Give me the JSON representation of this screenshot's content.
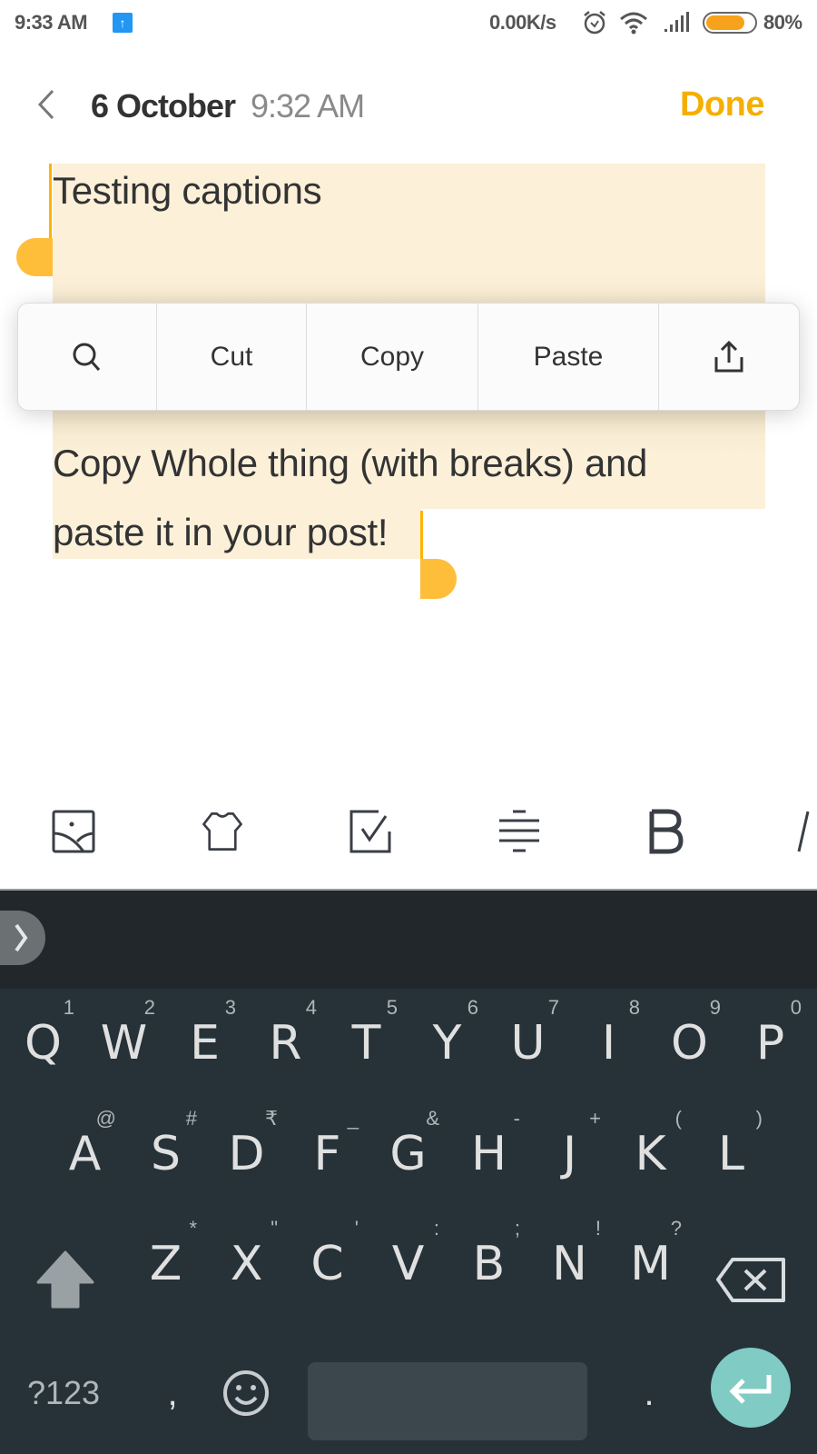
{
  "status_bar": {
    "time": "9:33 AM",
    "upload_icon": "upload-arrow-icon",
    "net_speed": "0.00K/s",
    "icons": [
      "alarm-icon",
      "wifi-icon",
      "signal-icon",
      "battery-icon"
    ],
    "battery_percent": "80%",
    "battery_level": 0.8
  },
  "header": {
    "back_icon": "chevron-left-icon",
    "date": "6 October",
    "time": "9:32 AM",
    "done_label": "Done"
  },
  "note": {
    "lines": [
      "Testing captions",
      "Copy Whole thing (with breaks) and",
      "paste it in your post!"
    ]
  },
  "context_menu": {
    "search_icon": "search-icon",
    "cut": "Cut",
    "copy": "Copy",
    "paste": "Paste",
    "share_icon": "share-icon"
  },
  "toolbar": {
    "items": [
      "image-icon",
      "theme-shirt-icon",
      "checklist-icon",
      "align-icon",
      "bold-icon",
      "italic-icon"
    ],
    "bold_glyph": "B",
    "italic_glyph": "I"
  },
  "keyboard": {
    "row1": [
      {
        "key": "Q",
        "hint": "1"
      },
      {
        "key": "W",
        "hint": "2"
      },
      {
        "key": "E",
        "hint": "3"
      },
      {
        "key": "R",
        "hint": "4"
      },
      {
        "key": "T",
        "hint": "5"
      },
      {
        "key": "Y",
        "hint": "6"
      },
      {
        "key": "U",
        "hint": "7"
      },
      {
        "key": "I",
        "hint": "8"
      },
      {
        "key": "O",
        "hint": "9"
      },
      {
        "key": "P",
        "hint": "0"
      }
    ],
    "row2": [
      {
        "key": "A",
        "hint": "@"
      },
      {
        "key": "S",
        "hint": "#"
      },
      {
        "key": "D",
        "hint": "₹"
      },
      {
        "key": "F",
        "hint": "_"
      },
      {
        "key": "G",
        "hint": "&"
      },
      {
        "key": "H",
        "hint": "-"
      },
      {
        "key": "J",
        "hint": "+"
      },
      {
        "key": "K",
        "hint": "("
      },
      {
        "key": "L",
        "hint": ")"
      }
    ],
    "row3": [
      {
        "key": "Z",
        "hint": "*"
      },
      {
        "key": "X",
        "hint": "\""
      },
      {
        "key": "C",
        "hint": "'"
      },
      {
        "key": "V",
        "hint": ":"
      },
      {
        "key": "B",
        "hint": ";"
      },
      {
        "key": "N",
        "hint": "!"
      },
      {
        "key": "M",
        "hint": "?"
      }
    ],
    "symbols_label": "?123",
    "comma": ",",
    "period": ".",
    "enter_color": "#80CBC4"
  },
  "colors": {
    "accent": "#F5AF00",
    "selection": "#FCF0D9",
    "handle": "#FFBE3A",
    "keyboard_bg": "#263238"
  }
}
